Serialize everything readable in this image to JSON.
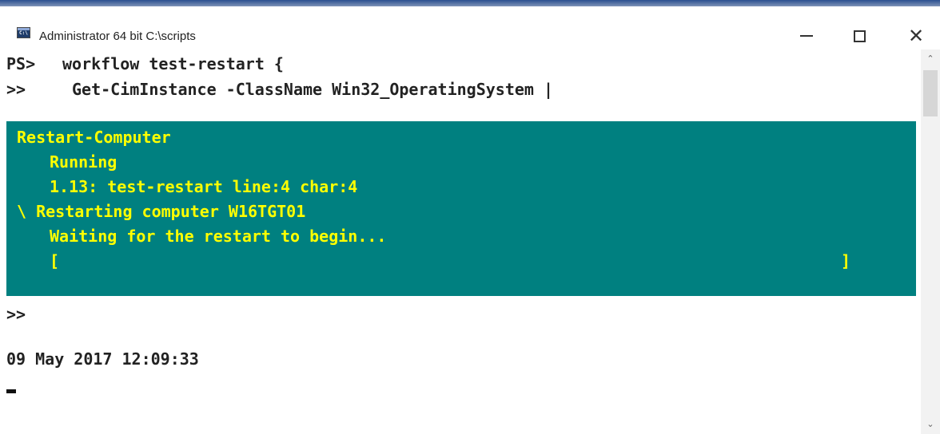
{
  "window": {
    "title": "Administrator 64 bit C:\\scripts",
    "icon": "console-icon",
    "controls": [
      "minimize-icon",
      "maximize-icon",
      "close-icon"
    ]
  },
  "console": {
    "lines": [
      {
        "prompt": "PS>",
        "text": "workflow test-restart {"
      },
      {
        "prompt": ">>",
        "text": "Get-CimInstance -ClassName Win32_OperatingSystem |"
      }
    ],
    "progress": {
      "activity": "Restart-Computer",
      "status": "Running",
      "location": "1.13: test-restart line:4 char:4",
      "sub_activity": "\\ Restarting computer W16TGT01",
      "sub_status": "Waiting for the restart to begin...",
      "bar_left": "[",
      "bar_right": "]",
      "percent_complete": 0
    },
    "after_prompt": ">>",
    "timestamp": "09 May 2017 12:09:33",
    "cursor": "▬"
  },
  "colors": {
    "progress_background": "#008080",
    "progress_text": "#ffff00",
    "console_text": "#222222"
  }
}
